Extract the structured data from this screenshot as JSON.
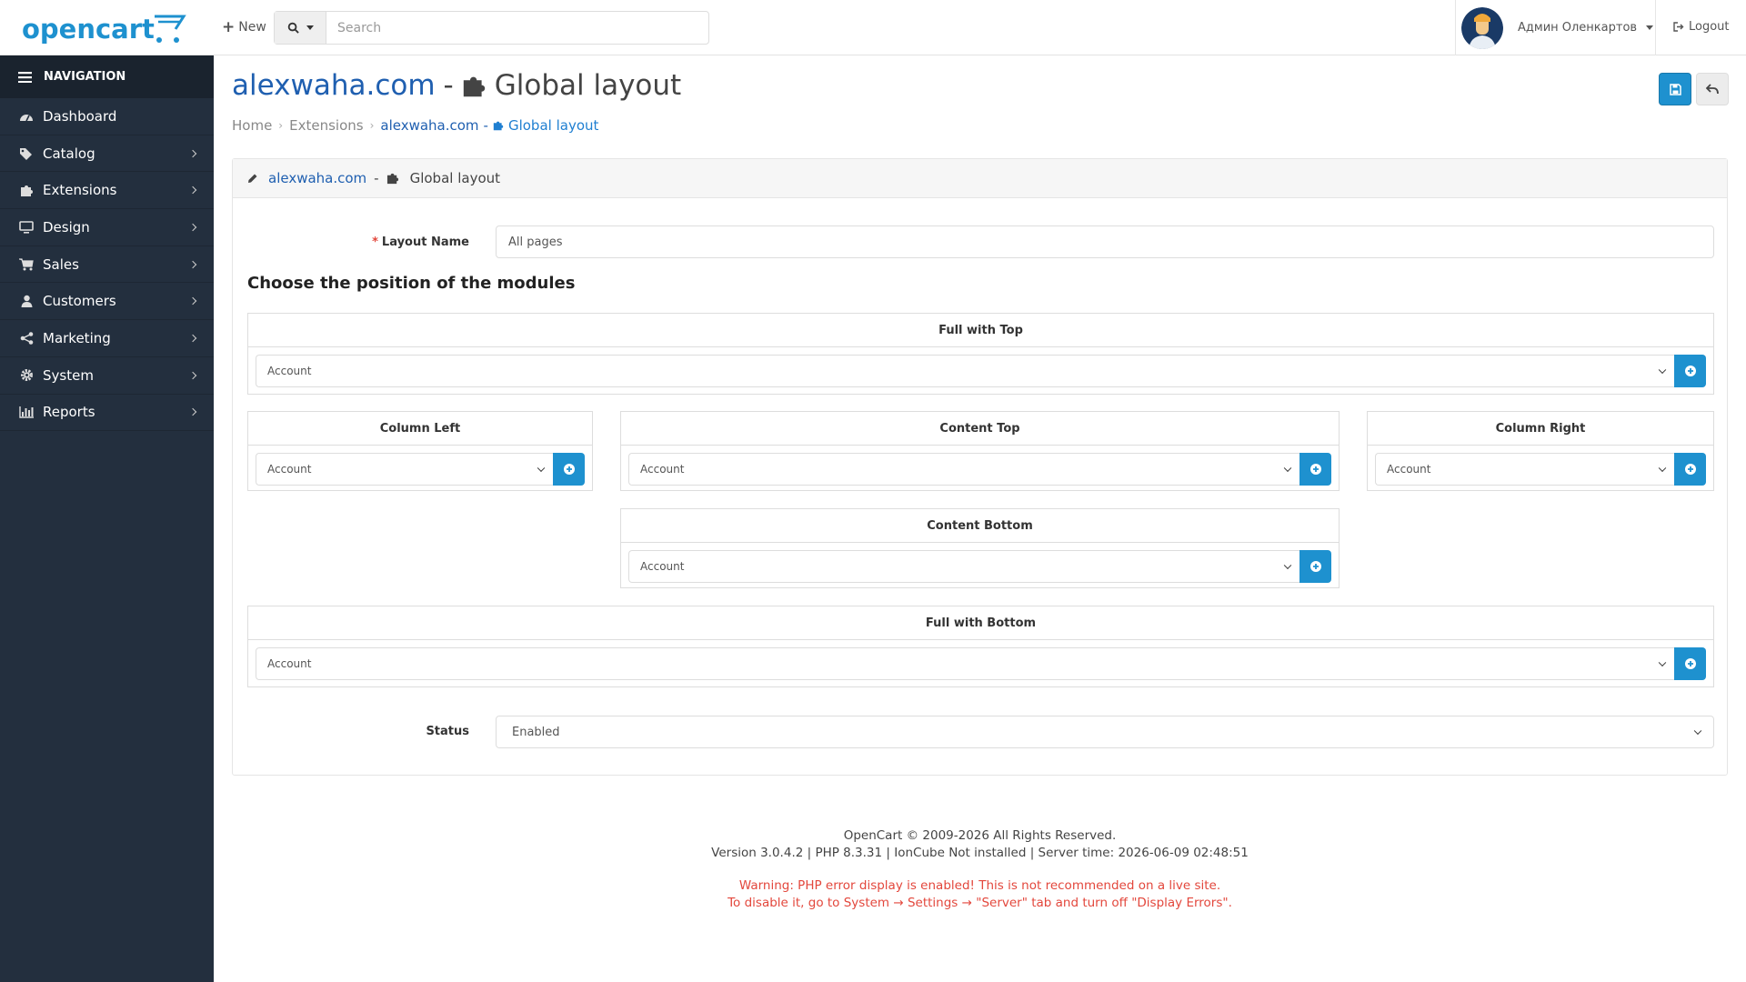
{
  "header": {
    "logo_text": "opencart",
    "new_label": "New",
    "search_placeholder": "Search",
    "username": "Админ Оленкартов",
    "logout_label": "Logout"
  },
  "sidebar": {
    "title": "NAVIGATION",
    "items": [
      {
        "label": "Dashboard",
        "icon": "dashboard-icon",
        "has_children": false
      },
      {
        "label": "Catalog",
        "icon": "tags-icon",
        "has_children": true
      },
      {
        "label": "Extensions",
        "icon": "puzzle-icon",
        "has_children": true
      },
      {
        "label": "Design",
        "icon": "monitor-icon",
        "has_children": true
      },
      {
        "label": "Sales",
        "icon": "cart-icon",
        "has_children": true
      },
      {
        "label": "Customers",
        "icon": "user-icon",
        "has_children": true
      },
      {
        "label": "Marketing",
        "icon": "share-icon",
        "has_children": true
      },
      {
        "label": "System",
        "icon": "gear-icon",
        "has_children": true
      },
      {
        "label": "Reports",
        "icon": "bar-chart-icon",
        "has_children": true
      }
    ]
  },
  "page": {
    "store": "alexwaha.com",
    "dash": "-",
    "title": "Global layout",
    "breadcrumb": [
      "Home",
      "Extensions",
      "alexwaha.com",
      "Global layout"
    ]
  },
  "panel": {
    "store": "alexwaha.com",
    "dash": "-",
    "title": "Global layout"
  },
  "form": {
    "required_mark": "*",
    "layout_name_label": "Layout Name",
    "layout_name_value": "All pages",
    "section_title": "Choose the position of the modules",
    "positions": {
      "full_top": {
        "title": "Full with Top",
        "selected": "Account"
      },
      "column_left": {
        "title": "Column Left",
        "selected": "Account"
      },
      "content_top": {
        "title": "Content Top",
        "selected": "Account"
      },
      "column_right": {
        "title": "Column Right",
        "selected": "Account"
      },
      "content_bottom": {
        "title": "Content Bottom",
        "selected": "Account"
      },
      "full_bottom": {
        "title": "Full with Bottom",
        "selected": "Account"
      }
    },
    "status_label": "Status",
    "status_value": "Enabled"
  },
  "footer": {
    "copyright": "OpenCart © 2009-2026 All Rights Reserved.",
    "version": "Version 3.0.4.2 | PHP 8.3.31 | IonCube Not installed | Server time: 2026-06-09 02:48:51",
    "warning_1": "Warning: PHP error display is enabled! This is not recommended on a live site.",
    "warning_2": "To disable it, go to System → Settings → \"Server\" tab and turn off \"Display Errors\"."
  },
  "colors": {
    "sidebar_bg": "#232f3e",
    "primary": "#1e91cf",
    "link": "#1f5fb0",
    "warning": "#e3473c"
  }
}
